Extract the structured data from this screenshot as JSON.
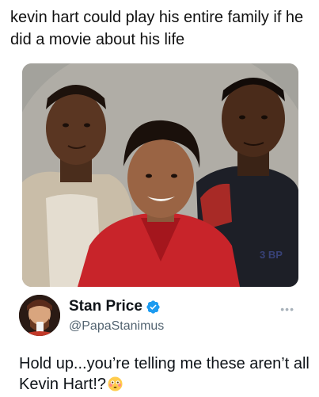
{
  "caption": "kevin hart could play his entire family if he did a movie about his life",
  "photo": {
    "watermark": "3 BP"
  },
  "tweet": {
    "author_name": "Stan Price",
    "handle": "@PapaStanimus",
    "more_label": "•••",
    "text": "Hold up...you’re telling me these aren’t all Kevin Hart!?",
    "emoji_name": "flushed-face-emoji",
    "verified_icon": "verified-badge-icon"
  },
  "colors": {
    "verified_blue": "#1d9bf0",
    "handle_gray": "#536471",
    "text_dark": "#0f1419"
  }
}
